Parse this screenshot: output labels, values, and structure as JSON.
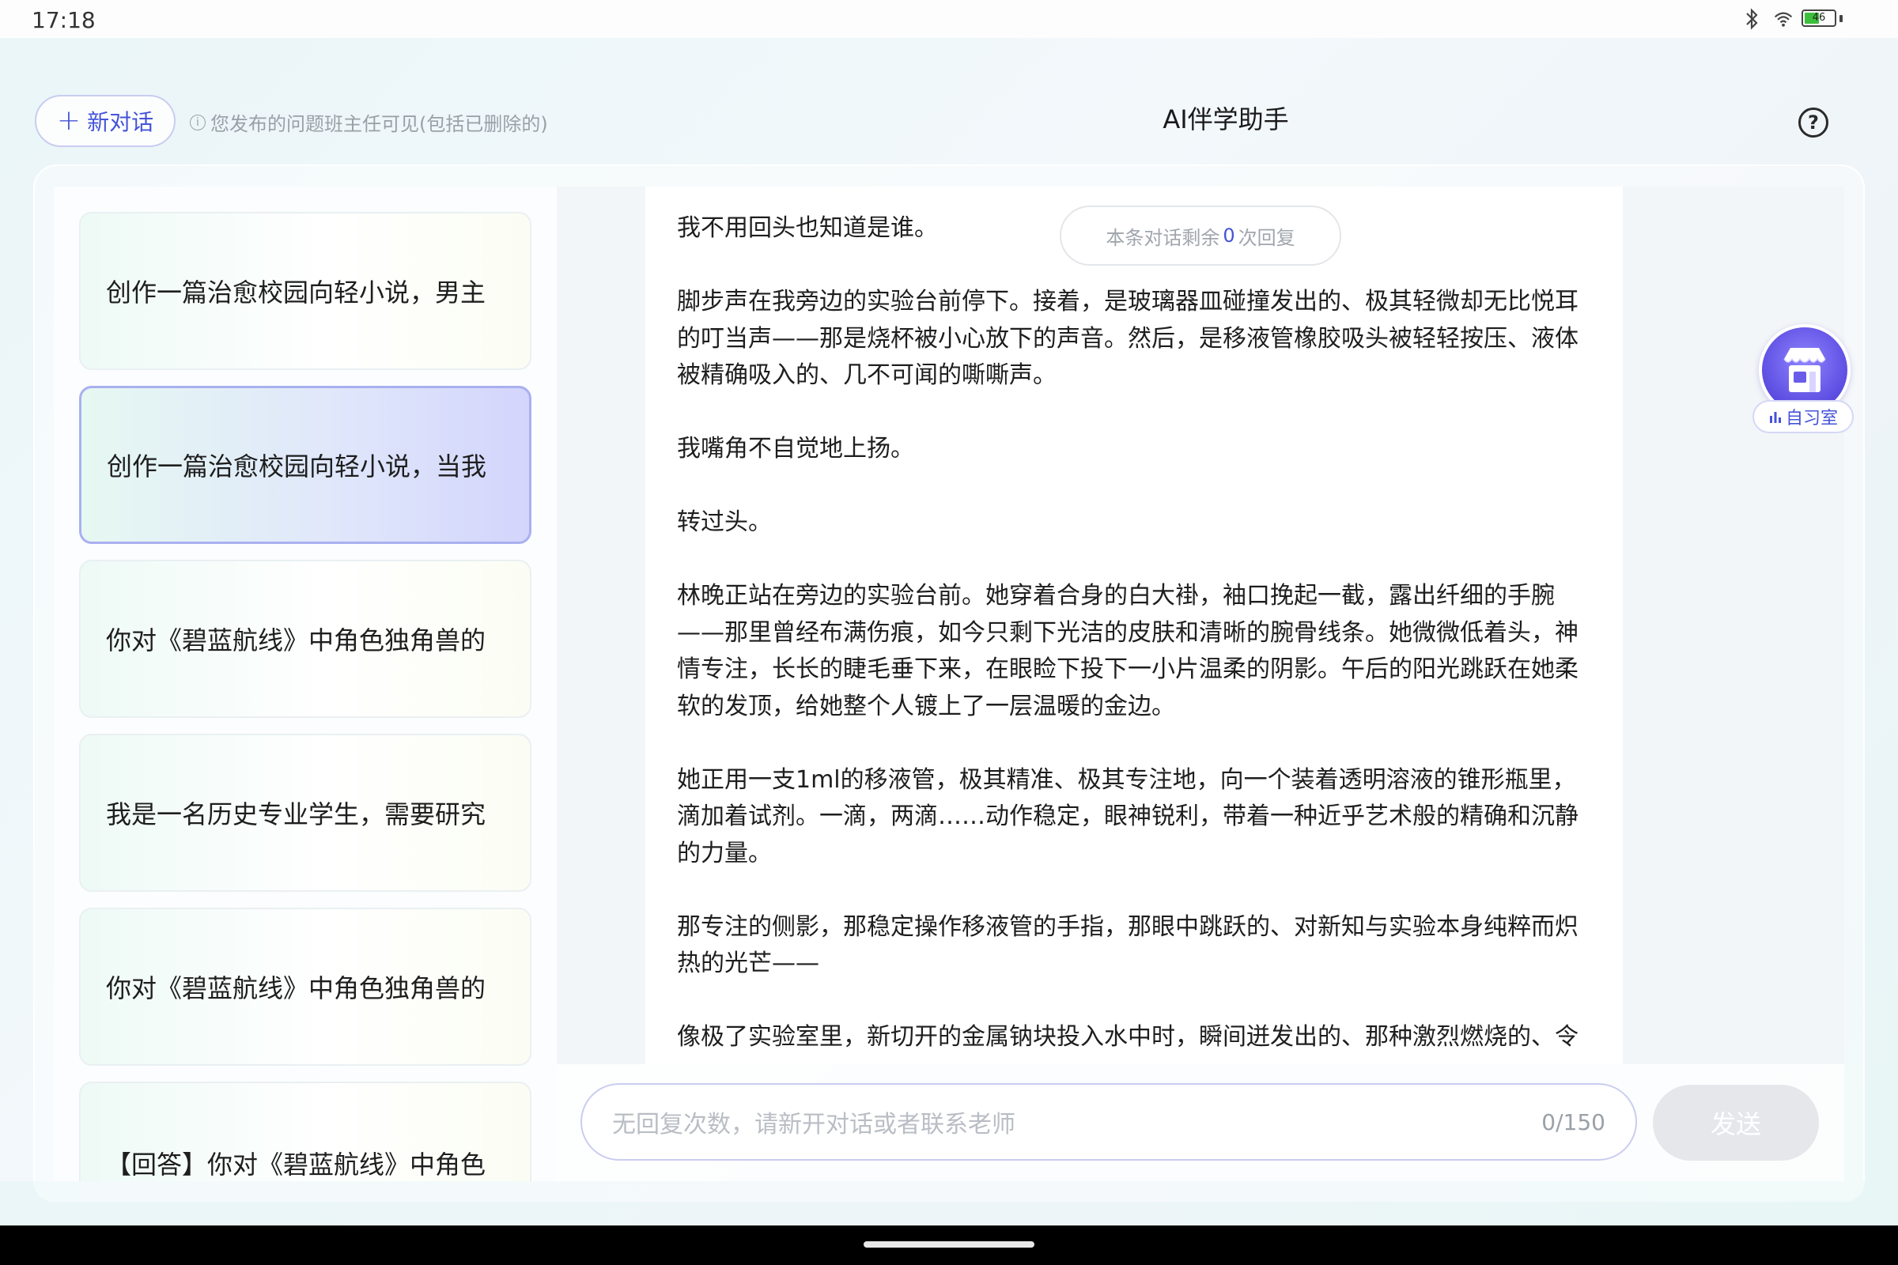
{
  "status": {
    "time": "17:18",
    "battery": "46"
  },
  "header": {
    "new_chat_label": "新对话",
    "notice": "您发布的问题班主任可见(包括已删除的)",
    "title": "AI伴学助手",
    "help": "?"
  },
  "sidebar": {
    "items": [
      {
        "label": "创作一篇治愈校园向轻小说，男主"
      },
      {
        "label": "创作一篇治愈校园向轻小说，当我"
      },
      {
        "label": "你对《碧蓝航线》中角色独角兽的"
      },
      {
        "label": "我是一名历史专业学生，需要研究"
      },
      {
        "label": "你对《碧蓝航线》中角色独角兽的"
      },
      {
        "label": "【回答】你对《碧蓝航线》中角色"
      }
    ]
  },
  "chat": {
    "remain_prefix": "本条对话剩余",
    "remain_count": "0",
    "remain_suffix": "次回复",
    "paragraphs": [
      "我不用回头也知道是谁。",
      "脚步声在我旁边的实验台前停下。接着，是玻璃器皿碰撞发出的、极其轻微却无比悦耳的叮当声——那是烧杯被小心放下的声音。然后，是移液管橡胶吸头被轻轻按压、液体被精确吸入的、几不可闻的嘶嘶声。",
      "我嘴角不自觉地上扬。",
      "转过头。",
      "林晚正站在旁边的实验台前。她穿着合身的白大褂，袖口挽起一截，露出纤细的手腕——那里曾经布满伤痕，如今只剩下光洁的皮肤和清晰的腕骨线条。她微微低着头，神情专注，长长的睫毛垂下来，在眼睑下投下一小片温柔的阴影。午后的阳光跳跃在她柔软的发顶，给她整个人镀上了一层温暖的金边。",
      "她正用一支1ml的移液管，极其精准、极其专注地，向一个装着透明溶液的锥形瓶里，滴加着试剂。一滴，两滴……动作稳定，眼神锐利，带着一种近乎艺术般的精确和沉静的力量。",
      "那专注的侧影，那稳定操作移液管的手指，那眼中跳跃的、对新知与实验本身纯粹而炽热的光芒——",
      "像极了实验室里，新切开的金属钠块投入水中时，瞬间迸发出的、那种激烈燃烧的、令"
    ]
  },
  "input": {
    "placeholder": "无回复次数，请新开对话或者联系老师",
    "count": "0/150",
    "send_label": "发送"
  },
  "study_room": {
    "label": "自习室",
    "badge": "自习"
  },
  "colors": {
    "accent": "#4553d8",
    "active_card": "#d3d5fb",
    "send_disabled": "#e5e7ea"
  }
}
